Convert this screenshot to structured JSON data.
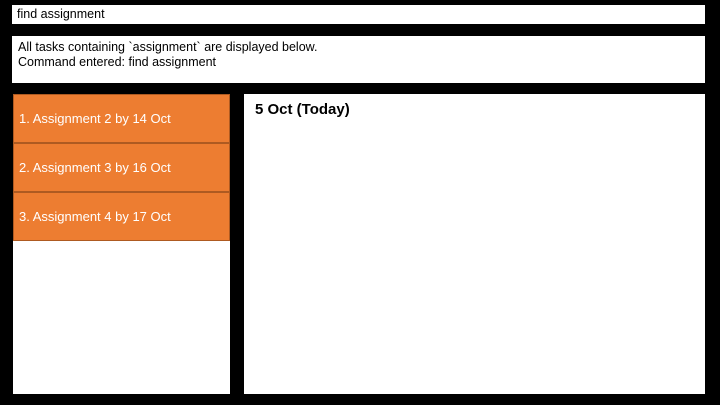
{
  "command_box": {
    "value": "find assignment"
  },
  "result_display": {
    "lines": [
      "All tasks containing `assignment` are displayed below.",
      "Command entered: find assignment"
    ]
  },
  "task_list": {
    "items": [
      {
        "label": "1. Assignment 2 by 14 Oct"
      },
      {
        "label": "2. Assignment 3 by 16 Oct"
      },
      {
        "label": "3. Assignment 4 by 17 Oct"
      }
    ]
  },
  "calendar": {
    "date_heading": "5 Oct (Today)"
  },
  "colors": {
    "background": "#000000",
    "panel": "#ffffff",
    "task_item": "#ED7D31",
    "task_item_border": "#AE5A21"
  }
}
